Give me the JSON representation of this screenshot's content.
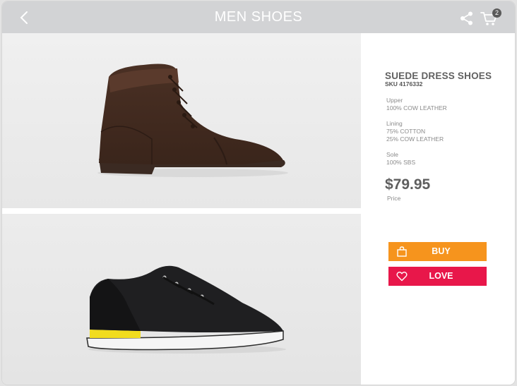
{
  "header": {
    "title": "MEN SHOES",
    "cart_count": "2",
    "back_icon": "chevron-left-icon",
    "share_icon": "share-icon",
    "cart_icon": "cart-icon"
  },
  "product": {
    "name": "SUEDE DRESS SHOES",
    "sku": "SKU 4176332",
    "specs": [
      {
        "label": "Upper",
        "values": [
          "100% COW LEATHER"
        ]
      },
      {
        "label": "Lining",
        "values": [
          "75% COTTON",
          "25% COW LEATHER"
        ]
      },
      {
        "label": "Sole",
        "values": [
          "100% SBS"
        ]
      }
    ],
    "price": "$79.95",
    "price_label": "Price"
  },
  "actions": {
    "buy_label": "BUY",
    "love_label": "LOVE",
    "buy_color": "#f6941d",
    "love_color": "#e8174a",
    "buy_icon": "shopping-bag-icon",
    "love_icon": "heart-icon"
  },
  "images": [
    {
      "subject": "brown-leather-boot"
    },
    {
      "subject": "black-sneaker"
    }
  ]
}
